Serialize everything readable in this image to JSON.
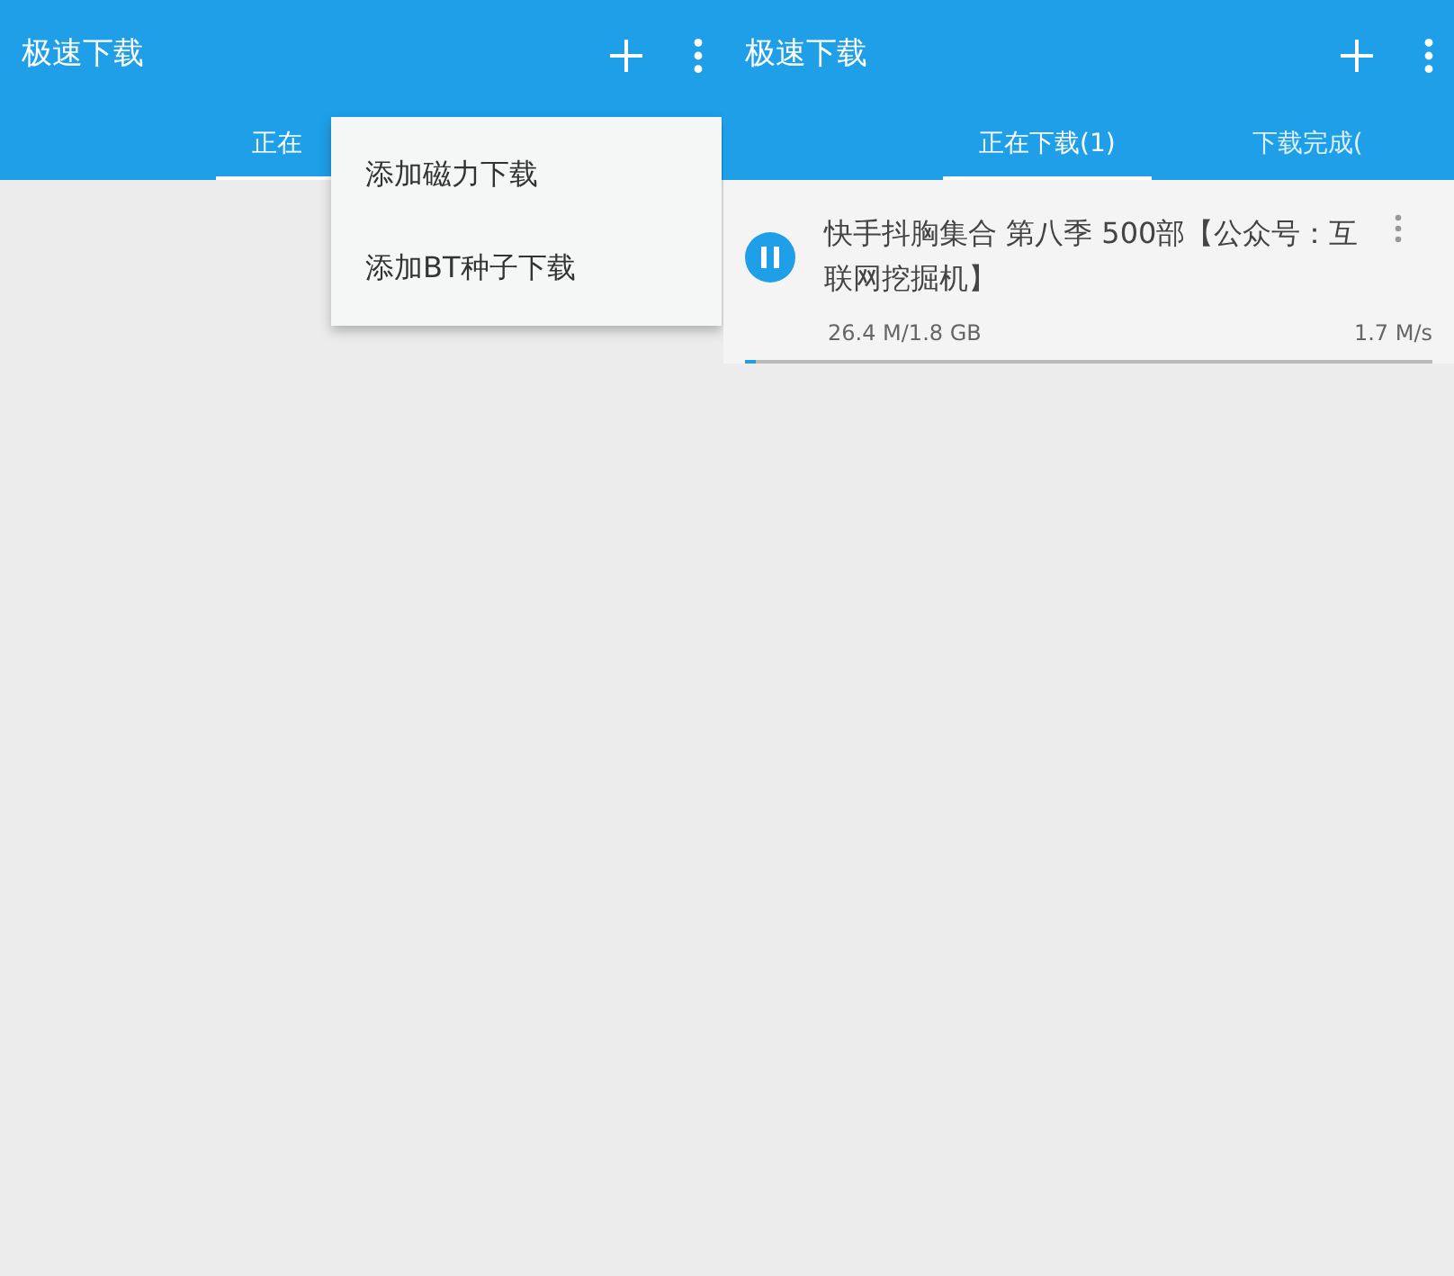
{
  "screens": [
    {
      "title": "极速下载",
      "tabs": [
        {
          "label": "正在",
          "selected": true
        }
      ],
      "menu": {
        "items": [
          {
            "label": "添加磁力下载"
          },
          {
            "label": "添加BT种子下载"
          }
        ]
      }
    },
    {
      "title": "极速下载",
      "tabs": [
        {
          "label": "正在下载(1)",
          "selected": true
        },
        {
          "label": "下载完成(",
          "selected": false
        }
      ],
      "downloads": [
        {
          "name": "快手抖胸集合 第八季 500部【公众号：互联网挖掘机】",
          "paused": false,
          "size": "26.4 M/1.8 GB",
          "speed": "1.7 M/s",
          "level": 0.015
        }
      ]
    }
  ]
}
